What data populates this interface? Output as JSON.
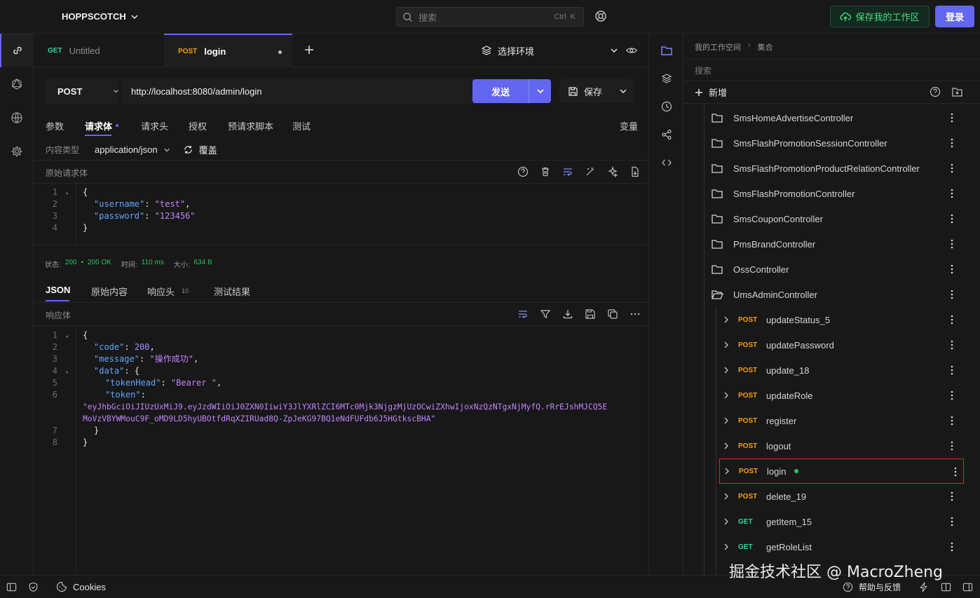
{
  "app": {
    "brand": "HOPPSCOTCH",
    "search_placeholder": "搜索",
    "search_kbd_1": "Ctrl",
    "search_kbd_2": "K",
    "save_workspace": "保存我的工作区",
    "login": "登录"
  },
  "tabs": [
    {
      "method": "GET",
      "title": "Untitled"
    },
    {
      "method": "POST",
      "title": "login"
    }
  ],
  "env_label": "选择环境",
  "request": {
    "method": "POST",
    "url": "http://localhost:8080/admin/login",
    "send": "发送",
    "save": "保存"
  },
  "req_tabs": {
    "params": "参数",
    "body": "请求体",
    "headers": "请求头",
    "auth": "授权",
    "prerequest": "预请求脚本",
    "tests": "测试",
    "variables": "变量"
  },
  "content_type": {
    "label": "内容类型",
    "value": "application/json",
    "override": "覆盖"
  },
  "raw_body_label": "原始请求体",
  "request_body_lines": [
    {
      "n": "1",
      "text": "{"
    },
    {
      "n": "2",
      "key": "\"username\"",
      "val": "\"test\""
    },
    {
      "n": "3",
      "key": "\"password\"",
      "val": "\"123456\""
    },
    {
      "n": "4",
      "text": "}"
    }
  ],
  "response_status": {
    "status_label": "状态:",
    "status_value": "200",
    "status_text": "200 OK",
    "time_label": "时间:",
    "time_value": "110 ms",
    "size_label": "大小:",
    "size_value": "634 B"
  },
  "resp_tabs": {
    "json": "JSON",
    "raw": "原始内容",
    "headers": "响应头",
    "headers_count": "10",
    "tests": "测试结果"
  },
  "response_body_label": "响应体",
  "response_lines": {
    "l1": "{",
    "code_key": "\"code\"",
    "code_val": "200",
    "msg_key": "\"message\"",
    "msg_val": "\"操作成功\"",
    "data_key": "\"data\"",
    "tokenhead_key": "\"tokenHead\"",
    "tokenhead_val": "\"Bearer \"",
    "token_key": "\"token\"",
    "token_val_1": "\"eyJhbGciOiJIUzUxMiJ9.eyJzdWIiOiJ0ZXN0IiwiY3JlYXRlZCI6MTc0Mjk3NjgzMjUzOCwiZXhwIjoxNzQzNTgxNjMyfQ.rRrEJshMJCQ5E",
    "token_val_2": "MoVzVBYWMouC9F_oMD9LD5hyUBOtfdRqXZIRUad8Q-ZpJeKG97BQ1eNdFUFdb6J5HGtkscBHA\"",
    "l7": "}",
    "l8": "}"
  },
  "collection": {
    "crumb_1": "我的工作空间",
    "crumb_2": "集合",
    "search_placeholder": "搜索",
    "new_label": "新增",
    "folders": [
      "SmsHomeAdvertiseController",
      "SmsFlashPromotionSessionController",
      "SmsFlashPromotionProductRelationController",
      "SmsFlashPromotionController",
      "SmsCouponController",
      "PmsBrandController",
      "OssController",
      "UmsAdminController"
    ],
    "requests": [
      {
        "method": "POST",
        "name": "updateStatus_5"
      },
      {
        "method": "POST",
        "name": "updatePassword"
      },
      {
        "method": "POST",
        "name": "update_18"
      },
      {
        "method": "POST",
        "name": "updateRole"
      },
      {
        "method": "POST",
        "name": "register"
      },
      {
        "method": "POST",
        "name": "logout"
      },
      {
        "method": "POST",
        "name": "login"
      },
      {
        "method": "POST",
        "name": "delete_19"
      },
      {
        "method": "GET",
        "name": "getItem_15"
      },
      {
        "method": "GET",
        "name": "getRoleList"
      }
    ]
  },
  "bottom": {
    "cookies": "Cookies",
    "help": "帮助与反馈"
  },
  "watermark": "掘金技术社区 @ MacroZheng",
  "colors": {
    "accent": "#6366f1",
    "post": "#f59e0b",
    "get": "#34d399",
    "selection_outline": "#dc2626"
  }
}
